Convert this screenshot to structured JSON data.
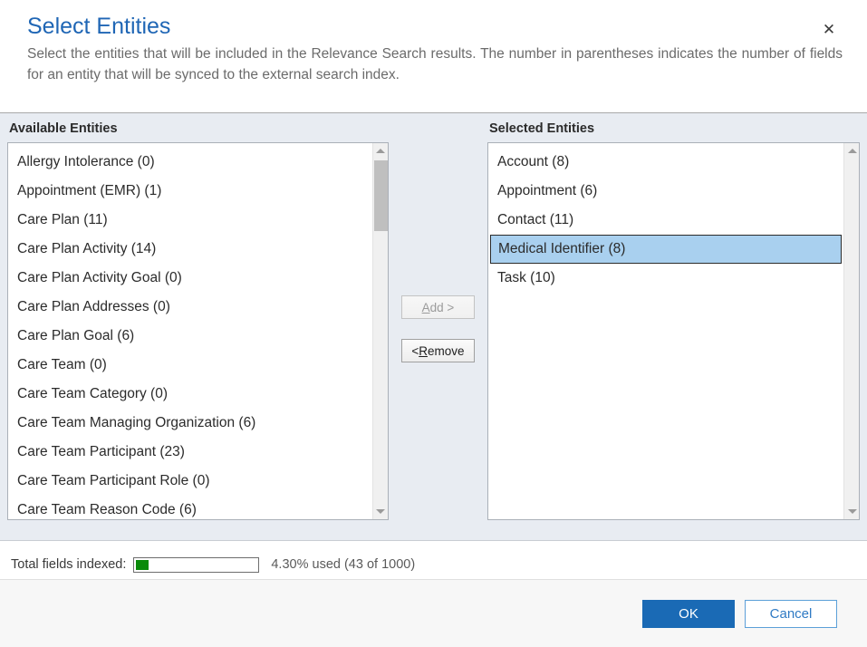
{
  "dialog": {
    "title": "Select Entities",
    "description": "Select the entities that will be included in the Relevance Search results. The number in parentheses indicates the number of fields for an entity that will be synced to the external search index.",
    "close_label": "✕"
  },
  "available": {
    "label": "Available Entities",
    "items": [
      "Allergy Intolerance (0)",
      "Appointment (EMR) (1)",
      "Care Plan (11)",
      "Care Plan Activity (14)",
      "Care Plan Activity Goal (0)",
      "Care Plan Addresses (0)",
      "Care Plan Goal (6)",
      "Care Team (0)",
      "Care Team Category (0)",
      "Care Team Managing Organization (6)",
      "Care Team Participant (23)",
      "Care Team Participant Role (0)",
      "Care Team Reason Code (6)"
    ]
  },
  "selected": {
    "label": "Selected Entities",
    "items": [
      {
        "label": "Account (8)",
        "selected": false
      },
      {
        "label": "Appointment (6)",
        "selected": false
      },
      {
        "label": "Contact (11)",
        "selected": false
      },
      {
        "label": "Medical Identifier (8)",
        "selected": true
      },
      {
        "label": "Task (10)",
        "selected": false
      }
    ]
  },
  "transfer": {
    "add_label": "Add >",
    "add_accesskey": "A",
    "add_enabled": false,
    "remove_label": "< Remove",
    "remove_accesskey": "R",
    "remove_enabled": true
  },
  "status": {
    "label": "Total fields indexed:",
    "percent": "4.30",
    "progress_percent": 4.3,
    "text": "4.30% used (43 of 1000)",
    "used": 43,
    "total": 1000,
    "bar_color": "#0a8a0a"
  },
  "footer": {
    "ok_label": "OK",
    "cancel_label": "Cancel",
    "primary_color": "#1a6ab5"
  },
  "theme": {
    "title_color": "#1f66b5",
    "panel_bg": "#e8ecf2",
    "selection_bg": "#a9d0ef"
  }
}
